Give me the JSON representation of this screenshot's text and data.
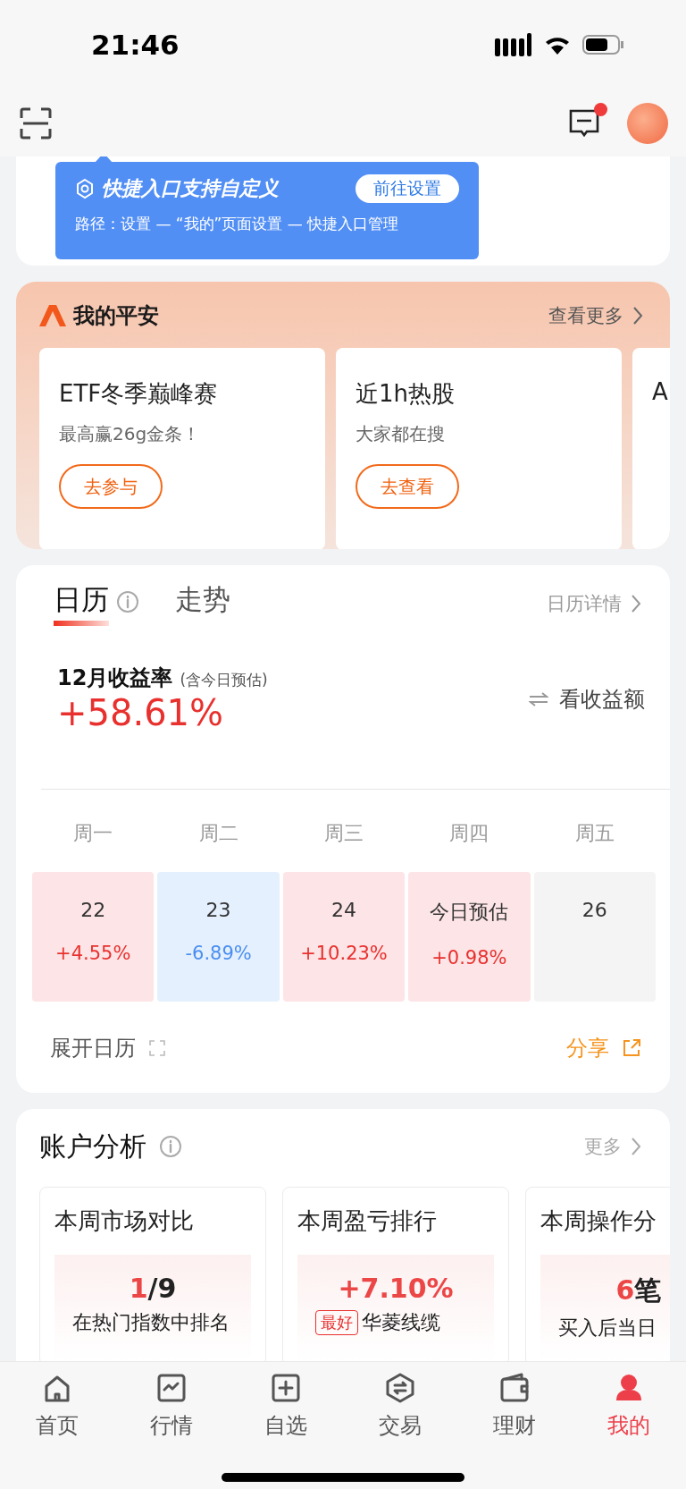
{
  "status_bar": {
    "time": "21:46"
  },
  "header": {
    "has_unread": true
  },
  "tooltip": {
    "title": "快捷入口支持自定义",
    "button": "前往设置",
    "path": "路径：设置 — “我的”页面设置 — 快捷入口管理"
  },
  "pingan": {
    "title": "我的平安",
    "more": "查看更多",
    "cards": [
      {
        "title": "ETF冬季巅峰赛",
        "subtitle": "最高赢26g金条！",
        "button": "去参与"
      },
      {
        "title": "近1h热股",
        "subtitle": "大家都在搜",
        "button": "去查看"
      },
      {
        "title": "A"
      }
    ]
  },
  "calendar": {
    "tabs": [
      {
        "label": "日历",
        "selected": true
      },
      {
        "label": "走势",
        "selected": false
      }
    ],
    "detail": "日历详情",
    "label": "12月收益率",
    "note": "(含今日预估)",
    "value": "+58.61%",
    "switch": "看收益额",
    "days": [
      {
        "weekday": "周一",
        "date": "22",
        "change": "+4.55%",
        "color": "#fde4e6"
      },
      {
        "weekday": "周二",
        "date": "23",
        "change": "-6.89%",
        "color": "#e5f0fe"
      },
      {
        "weekday": "周三",
        "date": "24",
        "change": "+10.23%",
        "color": "#fde4e6"
      },
      {
        "weekday": "周四",
        "date": "今日预估",
        "change": "+0.98%",
        "color": "#fde4e6"
      },
      {
        "weekday": "周五",
        "date": "26",
        "color": "#f4f4f4"
      }
    ],
    "expand": "展开日历",
    "share": "分享"
  },
  "analysis": {
    "title": "账户分析",
    "more": "更多",
    "cards": [
      {
        "title": "本周市场对比",
        "highlight": "1",
        "rest": "/9",
        "caption": "在热门指数中排名"
      },
      {
        "title": "本周盈亏排行",
        "highlight": "+7.10%",
        "tag": "最好",
        "caption": "华菱线缆"
      },
      {
        "title": "本周操作分",
        "highlight": "6",
        "rest": "笔",
        "caption": "买入后当日"
      }
    ]
  },
  "tab_bar": [
    {
      "label": "首页",
      "selected": false
    },
    {
      "label": "行情",
      "selected": false
    },
    {
      "label": "自选",
      "selected": false
    },
    {
      "label": "交易",
      "selected": false
    },
    {
      "label": "理财",
      "selected": false
    },
    {
      "label": "我的",
      "selected": true
    }
  ]
}
